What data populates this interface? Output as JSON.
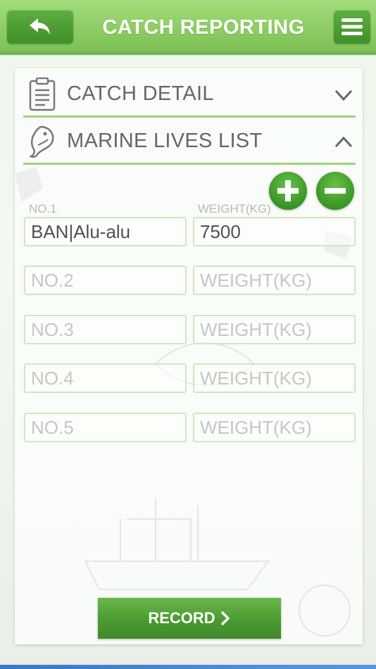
{
  "header": {
    "title": "CATCH REPORTING"
  },
  "sections": {
    "catch_detail": {
      "label": "CATCH DETAIL",
      "expanded": false
    },
    "marine_lives": {
      "label": "MARINE LIVES LIST",
      "expanded": true
    }
  },
  "list": {
    "label_no": "NO.1",
    "label_weight": "WEIGHT(KG)",
    "rows": [
      {
        "name_value": "BAN|Alu-alu",
        "name_placeholder": "NO.1",
        "weight_value": "7500",
        "weight_placeholder": "WEIGHT(KG)"
      },
      {
        "name_value": "",
        "name_placeholder": "NO.2",
        "weight_value": "",
        "weight_placeholder": "WEIGHT(KG)"
      },
      {
        "name_value": "",
        "name_placeholder": "NO.3",
        "weight_value": "",
        "weight_placeholder": "WEIGHT(KG)"
      },
      {
        "name_value": "",
        "name_placeholder": "NO.4",
        "weight_value": "",
        "weight_placeholder": "WEIGHT(KG)"
      },
      {
        "name_value": "",
        "name_placeholder": "NO.5",
        "weight_value": "",
        "weight_placeholder": "WEIGHT(KG)"
      }
    ]
  },
  "actions": {
    "record_label": "RECORD",
    "add_icon": "plus-circle-icon",
    "remove_icon": "minus-circle-icon"
  },
  "colors": {
    "header_green": "#8ccc62",
    "button_green": "#4a9a32",
    "divider_green": "#9fd27b",
    "field_border": "#cfe8bf"
  }
}
